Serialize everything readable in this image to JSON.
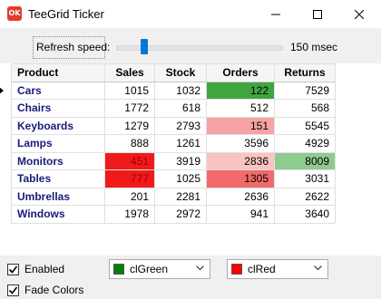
{
  "window": {
    "title": "TeeGrid Ticker",
    "icon_text": "OK"
  },
  "speed": {
    "label": "Refresh speed:",
    "value_text": "150 msec",
    "slider_fraction": 0.15
  },
  "grid": {
    "columns": [
      "Product",
      "Sales",
      "Stock",
      "Orders",
      "Returns"
    ],
    "rows": [
      {
        "product": "Cars",
        "sales": "1015",
        "stock": "1032",
        "orders": "122",
        "returns": "7529",
        "cls": [
          "",
          "",
          "c-green",
          ""
        ],
        "current": true
      },
      {
        "product": "Chairs",
        "sales": "1772",
        "stock": "618",
        "orders": "512",
        "returns": "568",
        "cls": [
          "",
          "",
          "",
          ""
        ]
      },
      {
        "product": "Keyboards",
        "sales": "1279",
        "stock": "2793",
        "orders": "151",
        "returns": "5545",
        "cls": [
          "",
          "",
          "c-pink",
          ""
        ]
      },
      {
        "product": "Lamps",
        "sales": "888",
        "stock": "1261",
        "orders": "3596",
        "returns": "4929",
        "cls": [
          "",
          "",
          "",
          ""
        ]
      },
      {
        "product": "Monitors",
        "sales": "451",
        "stock": "3919",
        "orders": "2836",
        "returns": "8009",
        "cls": [
          "c-red",
          "",
          "c-lightpink",
          "c-lightgreen"
        ]
      },
      {
        "product": "Tables",
        "sales": "777",
        "stock": "1025",
        "orders": "1305",
        "returns": "3031",
        "cls": [
          "c-red",
          "",
          "c-salmon",
          ""
        ]
      },
      {
        "product": "Umbrellas",
        "sales": "201",
        "stock": "2281",
        "orders": "2636",
        "returns": "2622",
        "cls": [
          "",
          "",
          "",
          ""
        ]
      },
      {
        "product": "Windows",
        "sales": "1978",
        "stock": "2972",
        "orders": "941",
        "returns": "3640",
        "cls": [
          "",
          "",
          "",
          ""
        ]
      }
    ]
  },
  "options": {
    "enabled_label": "Enabled",
    "enabled": true,
    "fade_label": "Fade Colors",
    "fade": true,
    "up_color": {
      "label": "clGreen",
      "hex": "#008000"
    },
    "down_color": {
      "label": "clRed",
      "hex": "#ff0000"
    }
  }
}
